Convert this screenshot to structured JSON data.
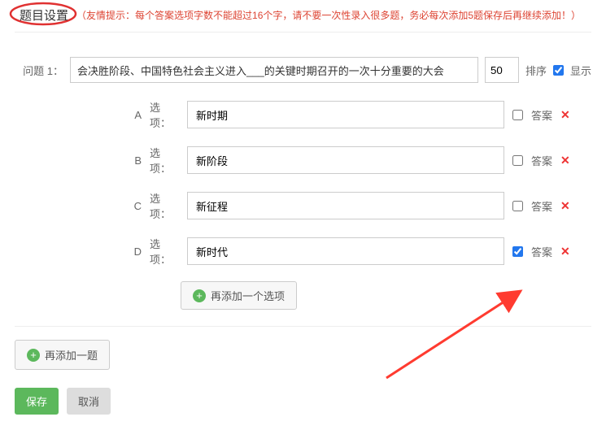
{
  "header": {
    "title": "题目设置",
    "tip": "（友情提示：每个答案选项字数不能超过16个字，请不要一次性录入很多题，务必每次添加5题保存后再继续添加！）"
  },
  "question": {
    "label": "问题 1：",
    "value": "会决胜阶段、中国特色社会主义进入___的关键时期召开的一次十分重要的大会",
    "sort_value": "50",
    "sort_label": "排序",
    "show_label": "显示",
    "show_checked": true
  },
  "option_labels": {
    "option_text": "选项：",
    "answer_text": "答案"
  },
  "options": [
    {
      "letter": "A",
      "value": "新时期",
      "is_answer": false
    },
    {
      "letter": "B",
      "value": "新阶段",
      "is_answer": false
    },
    {
      "letter": "C",
      "value": "新征程",
      "is_answer": false
    },
    {
      "letter": "D",
      "value": "新时代",
      "is_answer": true
    }
  ],
  "buttons": {
    "add_option": "再添加一个选项",
    "add_question": "再添加一题",
    "save": "保存",
    "cancel": "取消"
  },
  "icons": {
    "delete": "✕",
    "plus": "+"
  },
  "annotation": {
    "arrow_color": "#ff3b30"
  }
}
